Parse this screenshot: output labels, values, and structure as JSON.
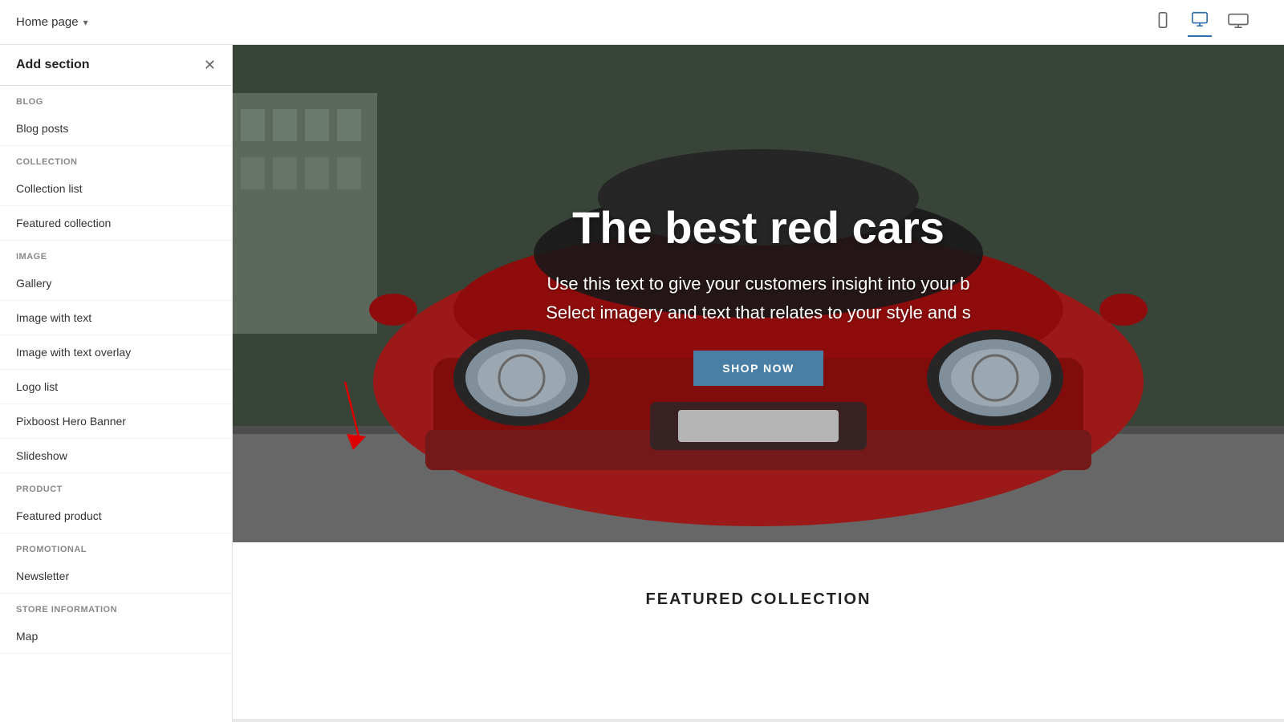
{
  "header": {
    "page_label": "Home page",
    "chevron": "▾",
    "devices": [
      {
        "name": "mobile",
        "icon": "📱",
        "active": false
      },
      {
        "name": "desktop",
        "icon": "🖥",
        "active": true
      },
      {
        "name": "wide",
        "icon": "⊞",
        "active": false
      }
    ]
  },
  "sidebar": {
    "title": "Add section",
    "close_icon": "✕",
    "categories": [
      {
        "name": "BLOG",
        "items": [
          "Blog posts"
        ]
      },
      {
        "name": "COLLECTION",
        "items": [
          "Collection list",
          "Featured collection"
        ]
      },
      {
        "name": "IMAGE",
        "items": [
          "Gallery",
          "Image with text",
          "Image with text overlay",
          "Logo list",
          "Pixboost Hero Banner",
          "Slideshow"
        ]
      },
      {
        "name": "PRODUCT",
        "items": [
          "Featured product"
        ]
      },
      {
        "name": "PROMOTIONAL",
        "items": [
          "Newsletter"
        ]
      },
      {
        "name": "STORE INFORMATION",
        "items": [
          "Map"
        ]
      }
    ]
  },
  "hero": {
    "title": "The best red cars",
    "subtitle_line1": "Use this text to give your customers insight into your b",
    "subtitle_line2": "Select imagery and text that relates to your style and s",
    "button_label": "SHOP NOW"
  },
  "featured_collection": {
    "title": "FEATURED COLLECTION"
  },
  "colors": {
    "accent_blue": "#2c6fad",
    "button_bg": "#4a7fa5",
    "arrow_red": "#dd0000",
    "category_text": "#888888"
  }
}
